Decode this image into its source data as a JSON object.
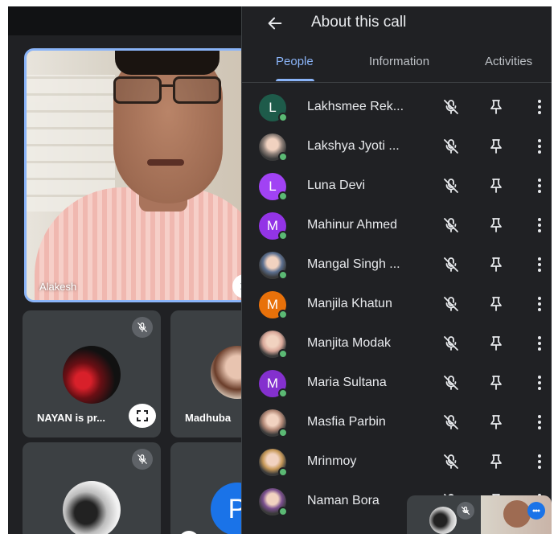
{
  "panel": {
    "title": "About this call",
    "tabs": [
      {
        "label": "People",
        "active": true
      },
      {
        "label": "Information",
        "active": false
      },
      {
        "label": "Activities",
        "active": false
      }
    ]
  },
  "main_tile": {
    "name": "Alakesh"
  },
  "tiles": [
    {
      "name": "NAYAN is pr..."
    },
    {
      "name": "Madhuba"
    },
    {
      "name": ""
    },
    {
      "initial": "P"
    }
  ],
  "people": [
    {
      "name": "Lakhsmee Rek...",
      "initial": "L",
      "avatar_color": "#1e5b4a",
      "photo": false
    },
    {
      "name": "Lakshya Jyoti ...",
      "initial": "",
      "avatar_color": "#8d7f78",
      "photo": true
    },
    {
      "name": "Luna Devi",
      "initial": "L",
      "avatar_color": "#a142f4",
      "photo": false
    },
    {
      "name": "Mahinur Ahmed",
      "initial": "M",
      "avatar_color": "#9334e6",
      "photo": false
    },
    {
      "name": "Mangal Singh ...",
      "initial": "",
      "avatar_color": "#5b6f8f",
      "photo": true
    },
    {
      "name": "Manjila Khatun",
      "initial": "M",
      "avatar_color": "#e8710a",
      "photo": false
    },
    {
      "name": "Manjita Modak",
      "initial": "",
      "avatar_color": "#d9a89a",
      "photo": true
    },
    {
      "name": "Maria Sultana",
      "initial": "M",
      "avatar_color": "#8430ce",
      "photo": false
    },
    {
      "name": "Masfia Parbin",
      "initial": "",
      "avatar_color": "#b48a78",
      "photo": true
    },
    {
      "name": "Mrinmoy",
      "initial": "",
      "avatar_color": "#c89a5a",
      "photo": true
    },
    {
      "name": "Naman Bora",
      "initial": "",
      "avatar_color": "#7a4f8e",
      "photo": true
    }
  ],
  "icons": {
    "back": "arrow-left-icon",
    "mute": "mic-off-icon",
    "pin": "pin-icon",
    "more": "more-vert-icon",
    "frame": "fullscreen-icon"
  },
  "colors": {
    "accent": "#8ab4f8",
    "panel_bg": "#202124",
    "presence": "#5bb974"
  }
}
